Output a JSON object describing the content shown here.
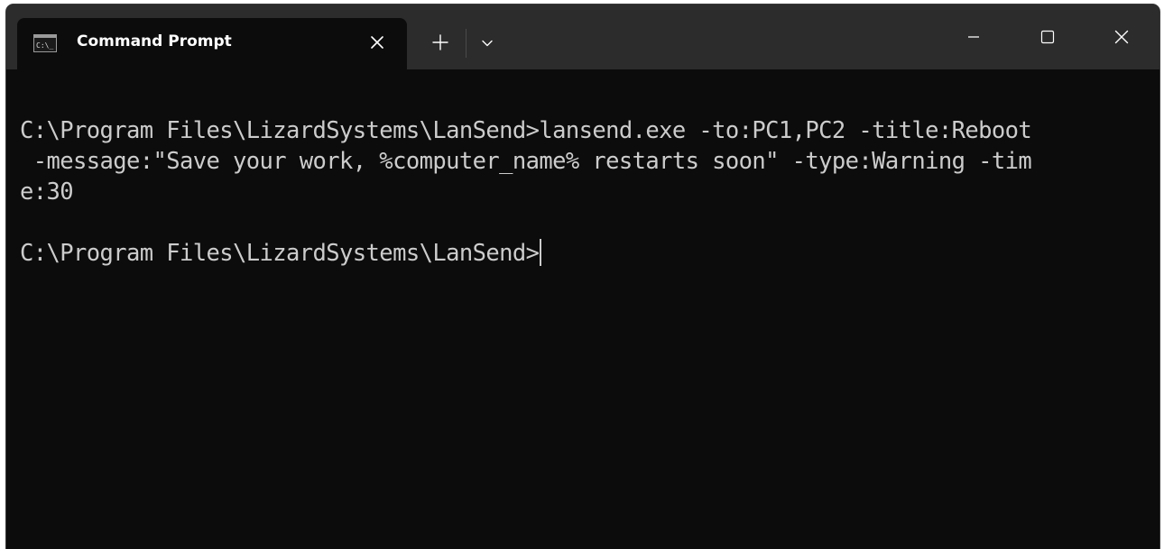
{
  "tab": {
    "title": "Command Prompt",
    "icon": "cmd-icon",
    "close_icon": "close-icon"
  },
  "titlebar": {
    "new_tab_icon": "plus-icon",
    "dropdown_icon": "chevron-down-icon",
    "minimize_icon": "minimize-icon",
    "maximize_icon": "maximize-icon",
    "close_icon": "close-icon"
  },
  "terminal": {
    "lines": [
      "C:\\Program Files\\LizardSystems\\LanSend>lansend.exe -to:PC1,PC2 -title:Reboot",
      " -message:\"Save your work, %computer_name% restarts soon\" -type:Warning -tim",
      "e:30",
      "",
      "C:\\Program Files\\LizardSystems\\LanSend>"
    ]
  },
  "colors": {
    "terminal_bg": "#0c0c0c",
    "titlebar_bg": "#2c2c2c",
    "text": "#cccccc"
  }
}
